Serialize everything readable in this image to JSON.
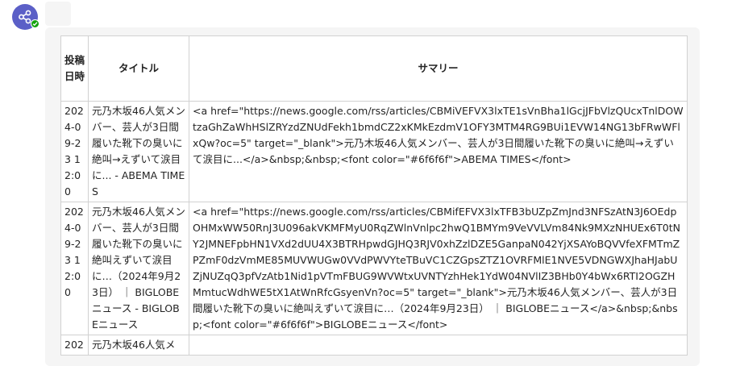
{
  "bot": {
    "avatar_icon": "network-share-icon",
    "avatar_color": "#5b5fc7",
    "status_color": "#13a10e"
  },
  "table": {
    "headers": {
      "date": "投稿日時",
      "title": "タイトル",
      "summary": "サマリー"
    },
    "rows": [
      {
        "date": "2024-09-23 12:00",
        "title": "元乃木坂46人気メンバー、芸人が3日間履いた靴下の臭いに絶叫→えずいて涙目に... - ABEMA TIMES",
        "summary": "<a href=\"https://news.google.com/rss/articles/CBMiVEFVX3lxTE1sVnBha1lGcjJFbVlzQUcxTnlDOWtzaGhZaWhHSlZRYzdZNUdFekh1bmdCZ2xKMkEzdmV1OFY3MTM4RG9BUi1EVW14NG13bFRwWFlxQw?oc=5\" target=\"_blank\">元乃木坂46人気メンバー、芸人が3日間履いた靴下の臭いに絶叫→えずいて涙目に...</a>&nbsp;&nbsp;<font color=\"#6f6f6f\">ABEMA TIMES</font>"
      },
      {
        "date": "2024-09-23 12:00",
        "title": "元乃木坂46人気メンバー、芸人が3日間履いた靴下の臭いに絶叫えずいて涙目に…（2024年9月23日） ｜ BIGLOBEニュース - BIGLOBEニュース",
        "summary": "<a href=\"https://news.google.com/rss/articles/CBMifEFVX3lxTFB3bUZpZmJnd3NFSzAtN3J6OEdpOHMxWW50RnJ3U096akVKMFMyU0RqZWlnVnlpc2hwQ1BMYm9VeVVLVm84Nk9MXzNHUEx6T0tNY2JMNEFpbHN1VXd2dUU4X3BTRHpwdGJHQ3RJV0xhZzlDZE5GanpaN042YjXSAYoBQVVfeXFMTmZPZmF0dzVmME85MUVWUGw0VVdPWVYteTBuVC1CZGpsZTZ1OVRFMlE1NVE5VDNGWXJhaHJabUZjNUZqQ3pfVzAtb1Nid1pVTmFBUG9WVWtxUVNTYzhHek1YdW04NVlIZ3BHb0Y4bWx6RTI2OGZHMmtucWdhWE5tX1AtWnRfcGsyenVn?oc=5\" target=\"_blank\">元乃木坂46人気メンバー、芸人が3日間履いた靴下の臭いに絶叫えずいて涙目に…（2024年9月23日） ｜ BIGLOBEニュース</a>&nbsp;&nbsp;<font color=\"#6f6f6f\">BIGLOBEニュース</font>"
      },
      {
        "date": "202",
        "title": "元乃木坂46人気メ",
        "summary": ""
      }
    ]
  }
}
